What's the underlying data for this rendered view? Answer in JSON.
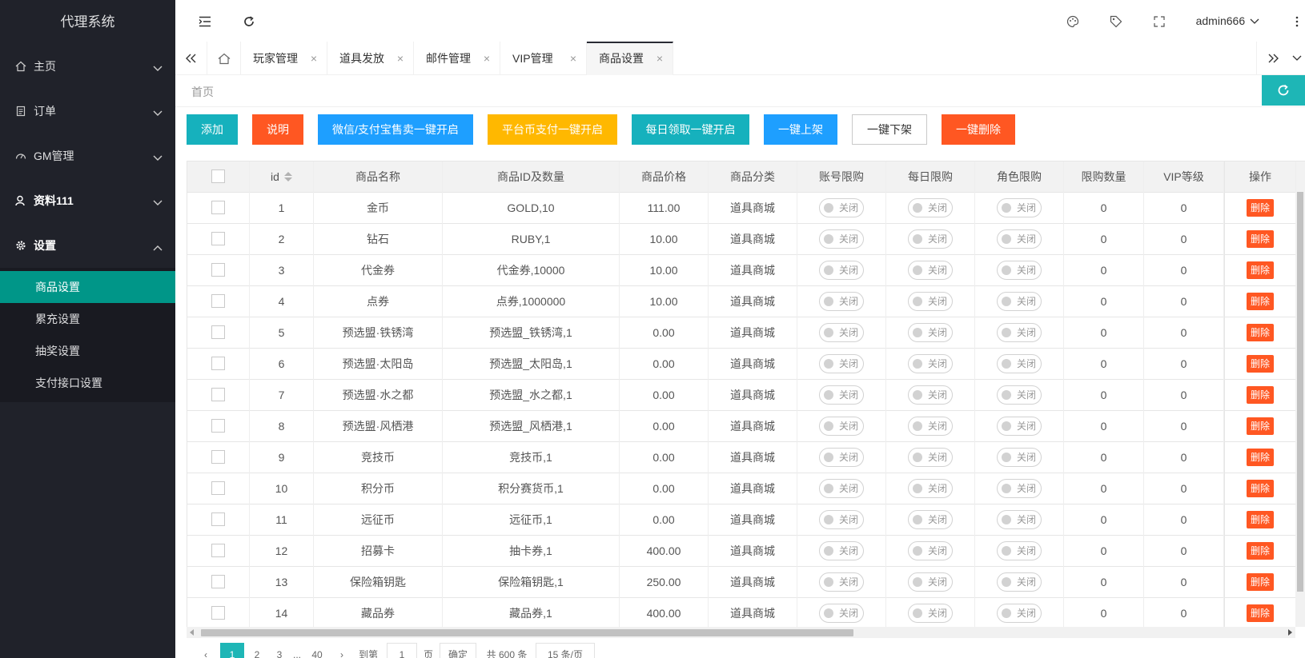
{
  "sidebar": {
    "logo": "代理系统",
    "groups": [
      {
        "label": "主页",
        "icon": "home-icon"
      },
      {
        "label": "订单",
        "icon": "document-icon"
      },
      {
        "label": "GM管理",
        "icon": "gauge-icon"
      },
      {
        "label": "资料111",
        "icon": "user-icon"
      },
      {
        "label": "设置",
        "icon": "gear-icon"
      }
    ],
    "submenu": [
      "商品设置",
      "累充设置",
      "抽奖设置",
      "支付接口设置"
    ]
  },
  "header": {
    "user": "admin666"
  },
  "tabs": [
    "玩家管理",
    "道具发放",
    "邮件管理",
    "VIP管理",
    "商品设置"
  ],
  "breadcrumb": "首页",
  "toolbar": [
    "添加",
    "说明",
    "微信/支付宝售卖一键开启",
    "平台币支付一键开启",
    "每日领取一键开启",
    "一键上架",
    "一键下架",
    "一键删除"
  ],
  "table": {
    "headers": [
      "id",
      "商品名称",
      "商品ID及数量",
      "商品价格",
      "商品分类",
      "账号限购",
      "每日限购",
      "角色限购",
      "限购数量",
      "VIP等级",
      "操作"
    ],
    "switch_label": "关闭",
    "delete_label": "删除",
    "rows": [
      [
        "1",
        "金币",
        "GOLD,10",
        "111.00",
        "道具商城",
        "0",
        "0"
      ],
      [
        "2",
        "钻石",
        "RUBY,1",
        "10.00",
        "道具商城",
        "0",
        "0"
      ],
      [
        "3",
        "代金券",
        "代金券,10000",
        "10.00",
        "道具商城",
        "0",
        "0"
      ],
      [
        "4",
        "点券",
        "点券,1000000",
        "10.00",
        "道具商城",
        "0",
        "0"
      ],
      [
        "5",
        "预选盟·铁锈湾",
        "预选盟_铁锈湾,1",
        "0.00",
        "道具商城",
        "0",
        "0"
      ],
      [
        "6",
        "预选盟·太阳岛",
        "预选盟_太阳岛,1",
        "0.00",
        "道具商城",
        "0",
        "0"
      ],
      [
        "7",
        "预选盟·水之都",
        "预选盟_水之都,1",
        "0.00",
        "道具商城",
        "0",
        "0"
      ],
      [
        "8",
        "预选盟·风栖港",
        "预选盟_风栖港,1",
        "0.00",
        "道具商城",
        "0",
        "0"
      ],
      [
        "9",
        "竞技币",
        "竞技币,1",
        "0.00",
        "道具商城",
        "0",
        "0"
      ],
      [
        "10",
        "积分币",
        "积分赛货币,1",
        "0.00",
        "道具商城",
        "0",
        "0"
      ],
      [
        "11",
        "远征币",
        "远征币,1",
        "0.00",
        "道具商城",
        "0",
        "0"
      ],
      [
        "12",
        "招募卡",
        "抽卡券,1",
        "400.00",
        "道具商城",
        "0",
        "0"
      ],
      [
        "13",
        "保险箱钥匙",
        "保险箱钥匙,1",
        "250.00",
        "道具商城",
        "0",
        "0"
      ],
      [
        "14",
        "藏品券",
        "藏品券,1",
        "400.00",
        "道具商城",
        "0",
        "0"
      ]
    ]
  },
  "pager": {
    "pages": [
      "1",
      "2",
      "3",
      "...",
      "40"
    ],
    "goto_prefix": "到第",
    "goto_value": "1",
    "goto_suffix": "页",
    "confirm": "确定",
    "total": "共 600 条",
    "per_page": "15 条/页"
  },
  "colors": {
    "sidebar_bg": "#20222a",
    "active": "#009688",
    "teal": "#16b1bd",
    "orange": "#ff5722",
    "blue": "#1e9fff",
    "yellow": "#ffb800"
  }
}
